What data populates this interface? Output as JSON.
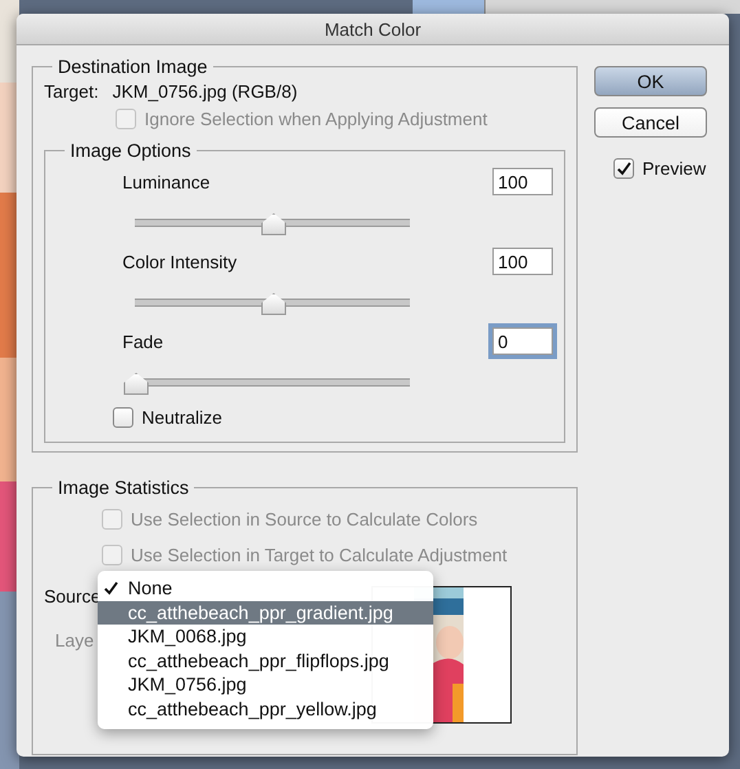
{
  "window": {
    "title": "Match Color"
  },
  "destination": {
    "title": "Destination Image",
    "target_label": "Target:",
    "target_value": "JKM_0756.jpg (RGB/8)",
    "ignore_selection": {
      "label": "Ignore Selection when Applying Adjustment",
      "checked": false,
      "disabled": true
    }
  },
  "image_options": {
    "title": "Image Options",
    "sliders": [
      {
        "label": "Luminance",
        "value": "100",
        "level": 0.5,
        "focused": false
      },
      {
        "label": "Color Intensity",
        "value": "100",
        "level": 0.5,
        "focused": false
      },
      {
        "label": "Fade",
        "value": "0",
        "level": 0,
        "focused": true
      }
    ],
    "neutralize": {
      "label": "Neutralize",
      "checked": false
    }
  },
  "image_statistics": {
    "title": "Image Statistics",
    "options": [
      {
        "label": "Use Selection in Source to Calculate Colors",
        "checked": false,
        "disabled": true
      },
      {
        "label": "Use Selection in Target to Calculate Adjustment",
        "checked": false,
        "disabled": true
      }
    ],
    "source_label": "Source",
    "layer_label": "Laye",
    "source_menu": [
      {
        "label": "None",
        "checked": true,
        "selected": false
      },
      {
        "label": "cc_atthebeach_ppr_gradient.jpg",
        "checked": false,
        "selected": true
      },
      {
        "label": "JKM_0068.jpg",
        "checked": false,
        "selected": false
      },
      {
        "label": "cc_atthebeach_ppr_flipflops.jpg",
        "checked": false,
        "selected": false
      },
      {
        "label": "JKM_0756.jpg",
        "checked": false,
        "selected": false
      },
      {
        "label": "cc_atthebeach_ppr_yellow.jpg",
        "checked": false,
        "selected": false
      }
    ]
  },
  "buttons": [
    {
      "label": "OK",
      "default": true
    },
    {
      "label": "Cancel",
      "default": false
    }
  ],
  "preview": {
    "label": "Preview",
    "checked": true
  }
}
